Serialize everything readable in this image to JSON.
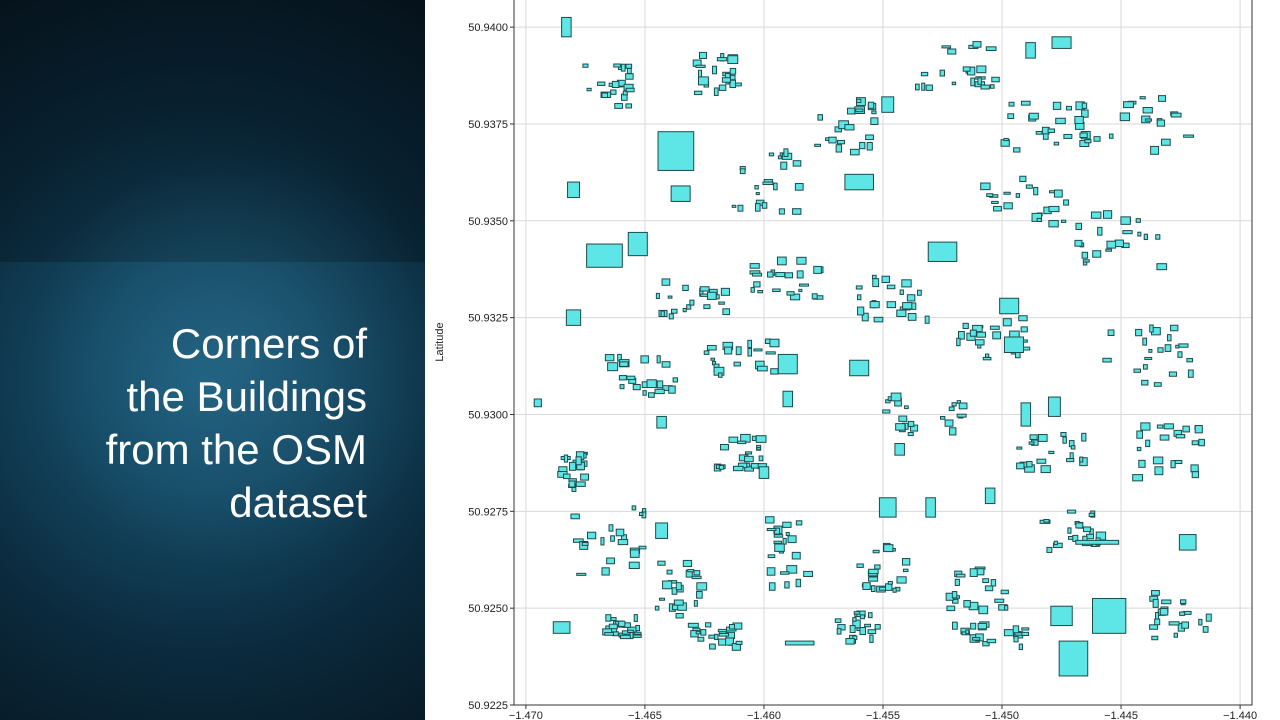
{
  "slide": {
    "title": "Corners of\nthe Buildings\nfrom the OSM\ndataset",
    "panel_color": "#0b2a3d",
    "title_color": "#ffffff"
  },
  "chart_data": {
    "type": "scatter",
    "title": "",
    "xlabel": "",
    "ylabel": "Latitude",
    "x_ticks": [
      -1.47,
      -1.465,
      -1.46,
      -1.455,
      -1.45,
      -1.445,
      -1.44
    ],
    "y_ticks": [
      50.9225,
      50.925,
      50.9275,
      50.93,
      50.9325,
      50.935,
      50.9375,
      50.94
    ],
    "x_tick_labels": [
      "−1.470",
      "−1.465",
      "−1.460",
      "−1.455",
      "−1.450",
      "−1.445",
      "−1.440"
    ],
    "y_tick_labels": [
      "50.9225",
      "50.9250",
      "50.9275",
      "50.9300",
      "50.9325",
      "50.9350",
      "50.9375",
      "50.9400"
    ],
    "xlim": [
      -1.4705,
      -1.4395
    ],
    "ylim": [
      50.9225,
      50.9407
    ],
    "grid": true,
    "fill_color": "#5ee6e6",
    "edge_color": "#1e4a4a",
    "buildings": [
      {
        "x": -1.4683,
        "y": 50.94,
        "w": 0.0004,
        "h": 0.0005
      },
      {
        "x": -1.4637,
        "y": 50.9368,
        "w": 0.0015,
        "h": 0.001
      },
      {
        "x": -1.468,
        "y": 50.9358,
        "w": 0.0005,
        "h": 0.0004
      },
      {
        "x": -1.4667,
        "y": 50.9341,
        "w": 0.0015,
        "h": 0.0006
      },
      {
        "x": -1.4653,
        "y": 50.9344,
        "w": 0.0008,
        "h": 0.0006
      },
      {
        "x": -1.4635,
        "y": 50.9357,
        "w": 0.0008,
        "h": 0.0004
      },
      {
        "x": -1.456,
        "y": 50.936,
        "w": 0.0012,
        "h": 0.0004
      },
      {
        "x": -1.4525,
        "y": 50.9342,
        "w": 0.0012,
        "h": 0.0005
      },
      {
        "x": -1.4495,
        "y": 50.9318,
        "w": 0.0008,
        "h": 0.0004
      },
      {
        "x": -1.4475,
        "y": 50.9396,
        "w": 0.0008,
        "h": 0.0003
      },
      {
        "x": -1.4488,
        "y": 50.9394,
        "w": 0.0004,
        "h": 0.0004
      },
      {
        "x": -1.4548,
        "y": 50.938,
        "w": 0.0005,
        "h": 0.0004
      },
      {
        "x": -1.4695,
        "y": 50.9303,
        "w": 0.0003,
        "h": 0.0002
      },
      {
        "x": -1.468,
        "y": 50.9325,
        "w": 0.0006,
        "h": 0.0004
      },
      {
        "x": -1.4643,
        "y": 50.9298,
        "w": 0.0004,
        "h": 0.0003
      },
      {
        "x": -1.459,
        "y": 50.9313,
        "w": 0.0008,
        "h": 0.0005
      },
      {
        "x": -1.456,
        "y": 50.9312,
        "w": 0.0008,
        "h": 0.0004
      },
      {
        "x": -1.459,
        "y": 50.9304,
        "w": 0.0004,
        "h": 0.0004
      },
      {
        "x": -1.4497,
        "y": 50.9328,
        "w": 0.0008,
        "h": 0.0004
      },
      {
        "x": -1.449,
        "y": 50.93,
        "w": 0.0004,
        "h": 0.0006
      },
      {
        "x": -1.4478,
        "y": 50.9302,
        "w": 0.0005,
        "h": 0.0005
      },
      {
        "x": -1.4548,
        "y": 50.9276,
        "w": 0.0007,
        "h": 0.0005
      },
      {
        "x": -1.4543,
        "y": 50.9291,
        "w": 0.0004,
        "h": 0.0003
      },
      {
        "x": -1.4505,
        "y": 50.9279,
        "w": 0.0004,
        "h": 0.0004
      },
      {
        "x": -1.4475,
        "y": 50.9248,
        "w": 0.0009,
        "h": 0.0005
      },
      {
        "x": -1.4455,
        "y": 50.9248,
        "w": 0.0014,
        "h": 0.0009
      },
      {
        "x": -1.447,
        "y": 50.9237,
        "w": 0.0012,
        "h": 0.0009
      },
      {
        "x": -1.4422,
        "y": 50.9267,
        "w": 0.0007,
        "h": 0.0004
      },
      {
        "x": -1.46,
        "y": 50.9285,
        "w": 0.0004,
        "h": 0.0003
      },
      {
        "x": -1.4685,
        "y": 50.9245,
        "w": 0.0007,
        "h": 0.0003
      },
      {
        "x": -1.4643,
        "y": 50.927,
        "w": 0.0005,
        "h": 0.0004
      },
      {
        "x": -1.4585,
        "y": 50.9241,
        "w": 0.0012,
        "h": 0.0001
      },
      {
        "x": -1.446,
        "y": 50.9267,
        "w": 0.0018,
        "h": 0.0001
      },
      {
        "x": -1.453,
        "y": 50.9276,
        "w": 0.0004,
        "h": 0.0005
      }
    ]
  }
}
